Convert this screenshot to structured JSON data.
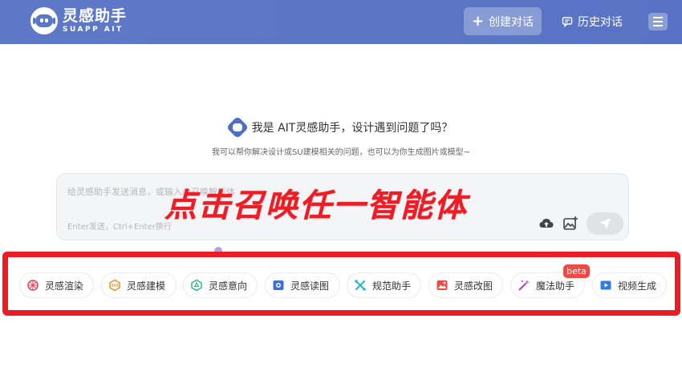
{
  "header": {
    "logo_title": "灵感助手",
    "logo_subtitle": "SUAPP AIT",
    "new_chat_label": "创建对话",
    "history_label": "历史对话"
  },
  "greeting": {
    "title": "我是 AIT灵感助手，设计遇到问题了吗？",
    "subtitle": "我可以帮你解决设计或SU建模相关的问题，也可以为你生成图片或模型~"
  },
  "input": {
    "placeholder": "给灵感助手发送消息，或输入@召唤智能体",
    "hint": "Enter发送，Ctrl+Enter换行"
  },
  "overlay_text": "点击召唤任一智能体",
  "tools": [
    {
      "label": "灵感渲染",
      "icon": "render-icon",
      "color": "#e0455a"
    },
    {
      "label": "灵感建模",
      "icon": "model-icon",
      "color": "#f08a2a"
    },
    {
      "label": "灵感意向",
      "icon": "intent-icon",
      "color": "#2fb58a"
    },
    {
      "label": "灵感读图",
      "icon": "read-image-icon",
      "color": "#3f6fd6"
    },
    {
      "label": "规范助手",
      "icon": "spec-icon",
      "color": "#2bb6c9"
    },
    {
      "label": "灵感改图",
      "icon": "edit-image-icon",
      "color": "#ee4b46"
    },
    {
      "label": "魔法助手",
      "icon": "magic-wand-icon",
      "color": "#c03fd6"
    },
    {
      "label": "视频生成",
      "icon": "video-icon",
      "color": "#2f7de8"
    }
  ],
  "badge": "beta",
  "colors": {
    "header": "#5a76c4",
    "highlight": "#ed1c24",
    "overlay": "#ee1c25"
  }
}
